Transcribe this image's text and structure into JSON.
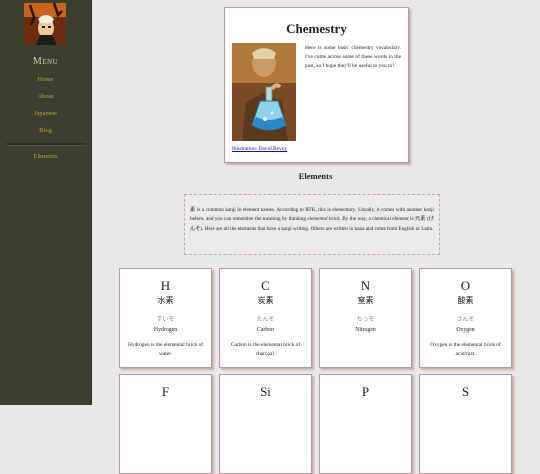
{
  "sidebar": {
    "menu_title": "Menu",
    "nav": [
      {
        "label": "Home"
      },
      {
        "label": "About"
      },
      {
        "label": "Japanese"
      },
      {
        "label": "Blog"
      }
    ],
    "sub_nav": [
      {
        "label": "Elements"
      }
    ]
  },
  "intro": {
    "title": "Chemestry",
    "text": "Here is some basic chemestry vocabulary. I've come across some of these words in the past, so I hope they'll be useful to you to!",
    "credit": "Illustration: David Revoy"
  },
  "elements_heading": "Elements",
  "note": {
    "p1": "素 is a common kanji in element names. According to RTK, this is ",
    "em1": "elementary",
    "p2": ". Usually, it comes with another kanji before, and you can remember the meaning by thinking ",
    "em2": "elemental brick",
    "p3": ". By the way, a chemical element is 元素 (げんそ). Here are all the elements that have a kanji writing. Others are written in kana and come from English or Latin."
  },
  "elements": [
    {
      "symbol": "H",
      "kanji": "水素",
      "reading": "すいそ",
      "name": "Hydrogen",
      "desc": "Hydrogen is the elemental brick of water."
    },
    {
      "symbol": "C",
      "kanji": "炭素",
      "reading": "たんそ",
      "name": "Carbon",
      "desc": "Carbon is the elemental brick of charcoal."
    },
    {
      "symbol": "N",
      "kanji": "窒素",
      "reading": "ちっそ",
      "name": "Nitrogen",
      "desc": ""
    },
    {
      "symbol": "O",
      "kanji": "酸素",
      "reading": "さんそ",
      "name": "Oxygen",
      "desc": "Oxygen is the elemental brick of acid/rust."
    },
    {
      "symbol": "F",
      "kanji": "",
      "reading": "",
      "name": "",
      "desc": ""
    },
    {
      "symbol": "Si",
      "kanji": "",
      "reading": "",
      "name": "",
      "desc": ""
    },
    {
      "symbol": "P",
      "kanji": "",
      "reading": "",
      "name": "",
      "desc": ""
    },
    {
      "symbol": "S",
      "kanji": "",
      "reading": "",
      "name": "",
      "desc": ""
    }
  ]
}
